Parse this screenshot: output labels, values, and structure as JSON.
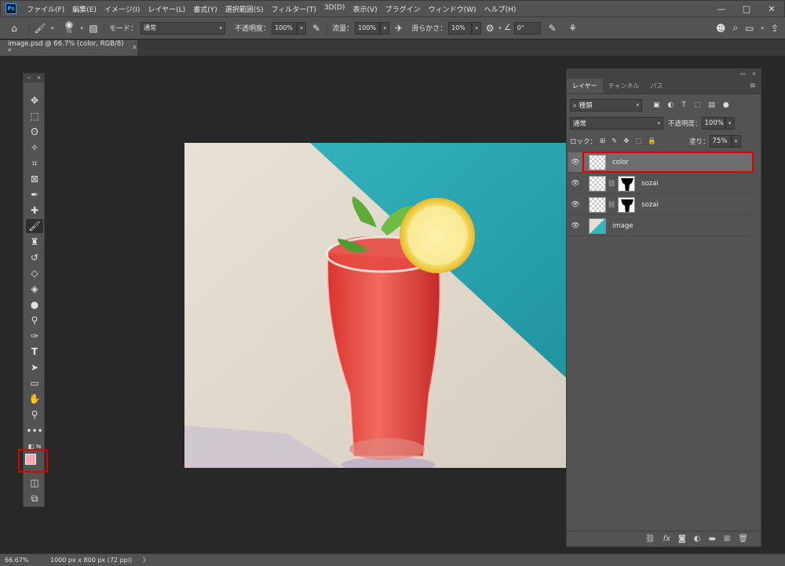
{
  "app": {
    "logo": "Ps",
    "menus": [
      "ファイル(F)",
      "編集(E)",
      "イメージ(I)",
      "レイヤー(L)",
      "書式(Y)",
      "選択範囲(S)",
      "フィルター(T)",
      "3D(D)",
      "表示(V)",
      "プラグイン",
      "ウィンドウ(W)",
      "ヘルプ(H)"
    ],
    "window_controls": [
      "—",
      "□",
      "✕"
    ]
  },
  "options": {
    "brush_size": "70",
    "mode_label": "モード：",
    "mode_value": "通常",
    "opacity_label": "不透明度：",
    "opacity_value": "100%",
    "flow_label": "流量：",
    "flow_value": "100%",
    "smoothing_label": "滑らかさ：",
    "smoothing_value": "10%",
    "angle_value": "0°"
  },
  "document": {
    "tab_title": "image.psd @ 66.7% (color, RGB/8) *",
    "close": "×"
  },
  "layers_panel": {
    "tabs": [
      "レイヤー",
      "チャンネル",
      "パス"
    ],
    "filter_kind": "種類",
    "blend_mode": "通常",
    "opacity_label": "不透明度：",
    "opacity_value": "100%",
    "lock_label": "ロック：",
    "fill_label": "塗り：",
    "fill_value": "75%",
    "layers": [
      {
        "name": "color",
        "selected": true
      },
      {
        "name": "sozai",
        "selected": false
      },
      {
        "name": "sozai",
        "selected": false
      },
      {
        "name": "image",
        "selected": false
      }
    ]
  },
  "status": {
    "zoom": "66.67%",
    "doc_size": "1000 px x 800 px (72 ppi)",
    "arrow": "〉"
  },
  "colors": {
    "foreground": "#f4a7ad",
    "background": "#ffffff",
    "highlight": "#e00000"
  }
}
